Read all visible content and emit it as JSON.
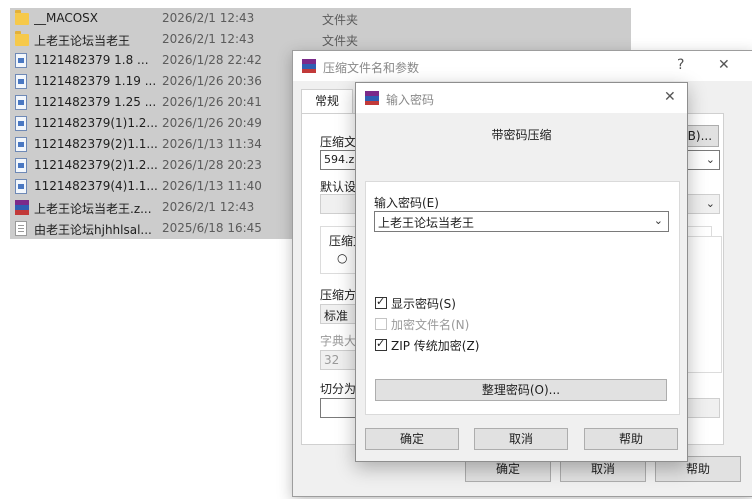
{
  "files": [
    {
      "icon": "folder",
      "name": "__MACOSX",
      "date": "2026/2/1 12:43",
      "type": "文件夹"
    },
    {
      "icon": "folder",
      "name": "上老王论坛当老王",
      "date": "2026/2/1 12:43",
      "type": "文件夹"
    },
    {
      "icon": "doc",
      "name": "1121482379 1.8 ...",
      "date": "2026/1/28 22:42",
      "type": ""
    },
    {
      "icon": "doc",
      "name": "1121482379 1.19 ...",
      "date": "2026/1/26 20:36",
      "type": ""
    },
    {
      "icon": "doc",
      "name": "1121482379 1.25 ...",
      "date": "2026/1/26 20:41",
      "type": ""
    },
    {
      "icon": "doc",
      "name": "1121482379(1)1.2...",
      "date": "2026/1/26 20:49",
      "type": ""
    },
    {
      "icon": "doc",
      "name": "1121482379(2)1.1...",
      "date": "2026/1/13 11:34",
      "type": ""
    },
    {
      "icon": "doc",
      "name": "1121482379(2)1.2...",
      "date": "2026/1/28 20:23",
      "type": ""
    },
    {
      "icon": "doc",
      "name": "1121482379(4)1.1...",
      "date": "2026/1/13 11:40",
      "type": ""
    },
    {
      "icon": "rar",
      "name": "上老王论坛当老王.z...",
      "date": "2026/2/1 12:43",
      "type": ""
    },
    {
      "icon": "txt",
      "name": "由老王论坛hjhhlsal...",
      "date": "2025/6/18 16:45",
      "type": ""
    }
  ],
  "archive_dialog": {
    "title": "压缩文件名和参数",
    "help_glyph": "?",
    "close_glyph": "✕",
    "tab_general": "常规",
    "archive_name_label": "压缩文",
    "browse_label": "(B)...",
    "archive_name_value": "594.zip",
    "default_profile_label": "默认设",
    "archive_format_label": "压缩文",
    "compression_method_label": "压缩方",
    "compression_method_value": "标准",
    "dictionary_label": "字典大",
    "dictionary_value": "32",
    "split_label": "切分为",
    "ok_label": "确定",
    "cancel_label": "取消",
    "help_label": "帮助"
  },
  "password_dialog": {
    "title": "输入密码",
    "close_glyph": "✕",
    "heading": "带密码压缩",
    "enter_password_label": "输入密码(E)",
    "password_value": "上老王论坛当老王",
    "show_password_label": "显示密码(S)",
    "show_password_checked": true,
    "encrypt_names_label": "加密文件名(N)",
    "encrypt_names_checked": false,
    "encrypt_names_enabled": false,
    "zip_legacy_label": "ZIP 传统加密(Z)",
    "zip_legacy_checked": true,
    "organize_label": "整理密码(O)...",
    "ok_label": "确定",
    "cancel_label": "取消",
    "help_label": "帮助"
  },
  "colors": {
    "selection": "#cccccc",
    "dialog_bg": "#f0f0f0",
    "folder": "#f6c94a",
    "rar_stripes": [
      "#7b2a8a",
      "#2f5fb3",
      "#c23a3a"
    ]
  }
}
